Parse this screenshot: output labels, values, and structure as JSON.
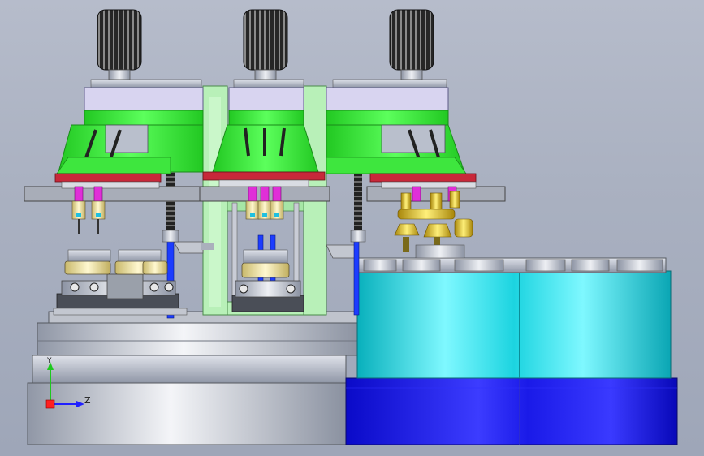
{
  "viewport": {
    "background_top": "#b6bccb",
    "background_bottom": "#9ea6b8"
  },
  "colors": {
    "head_green": "#3ee63e",
    "frame_green": "#b8f0b8",
    "cap_lavender": "#d8d4f0",
    "tray_red": "#c8283a",
    "table_cyan": "#22d8e0",
    "base_blue": "#1a1ae0",
    "brass": "#e8c020",
    "steel": "#9da3b2"
  },
  "spindle_count": 3,
  "triad": {
    "y_label": "Y",
    "z_label": "Z"
  }
}
